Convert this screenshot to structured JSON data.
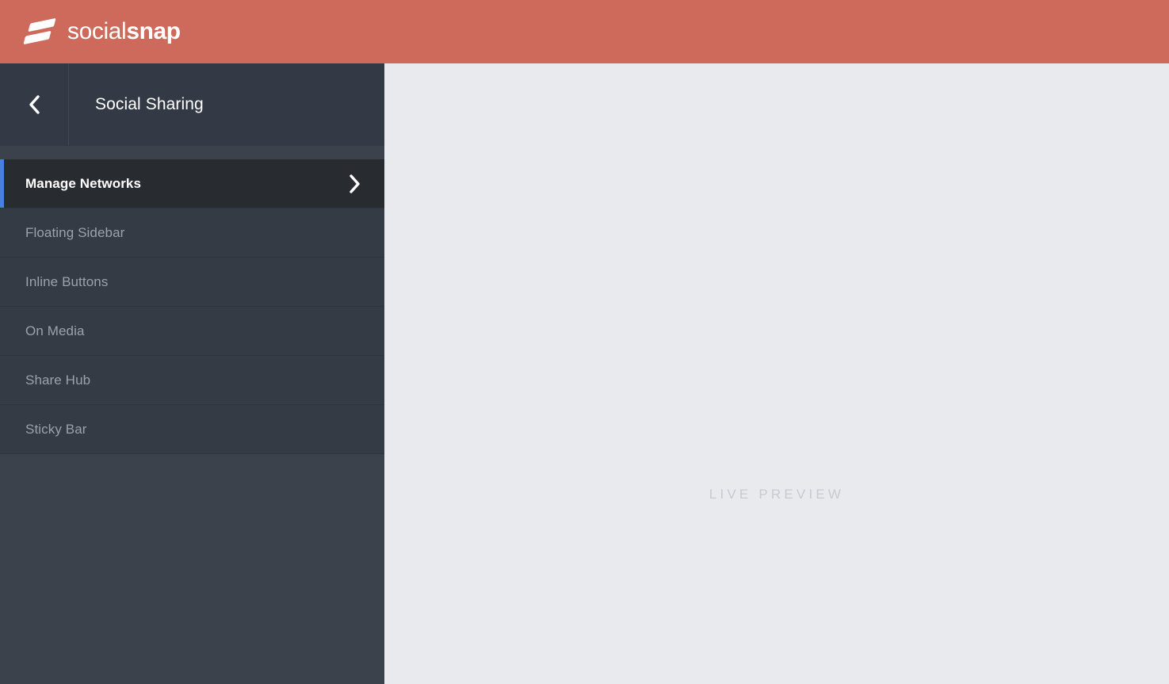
{
  "brand": {
    "logo_icon": "socialsnap-layers-icon",
    "name_light": "social",
    "name_bold": "snap",
    "bar_color": "#cd6a5b"
  },
  "panel": {
    "back_icon": "chevron-left-icon",
    "title": "Social Sharing",
    "background_color": "#3b424c",
    "active_color": "#282b30",
    "accent_color": "#4a7fe0",
    "items": [
      {
        "label": "Manage Networks",
        "active": true,
        "chevron_icon": "chevron-right-icon"
      },
      {
        "label": "Floating Sidebar",
        "active": false,
        "chevron_icon": ""
      },
      {
        "label": "Inline Buttons",
        "active": false,
        "chevron_icon": ""
      },
      {
        "label": "On Media",
        "active": false,
        "chevron_icon": ""
      },
      {
        "label": "Share Hub",
        "active": false,
        "chevron_icon": ""
      },
      {
        "label": "Sticky Bar",
        "active": false,
        "chevron_icon": ""
      }
    ]
  },
  "preview": {
    "placeholder": "Live Preview",
    "background_color": "#e9eaee",
    "text_color": "#c7cad1"
  }
}
